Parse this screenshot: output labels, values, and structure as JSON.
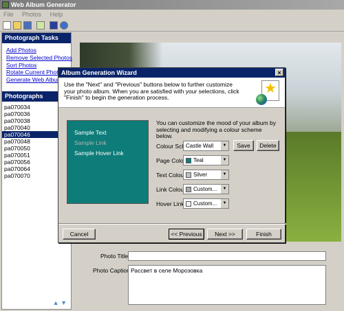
{
  "window": {
    "title": "Web Album Generator"
  },
  "menu": [
    "File",
    "Photos",
    "Help"
  ],
  "tasks": {
    "header": "Photograph Tasks",
    "items": [
      "Add Photos",
      "Remove Selected Photos",
      "Sort Photos",
      "Rotate Current Photo",
      "Generate Web Album"
    ]
  },
  "photographs": {
    "header": "Photographs",
    "items": [
      "pa070034",
      "pa070036",
      "pa070038",
      "pa070040",
      "pa070046",
      "pa070048",
      "pa070050",
      "pa070051",
      "pa070056",
      "pa070064",
      "pa070070"
    ],
    "selected": "pa070046"
  },
  "photo_title": {
    "label": "Photo Title:",
    "value": ""
  },
  "photo_caption": {
    "label": "Photo Caption:",
    "value": "Рассвет в селе Морозовка"
  },
  "dialog": {
    "title": "Album Generation Wizard",
    "close": "×",
    "description": "Use the \"Next\" and \"Previous\" buttons below to further customize your photo album. When you are satisfied with your selections, click \"Finish\" to begin the generation process.",
    "intro": "You can customize the mood of your album by selecting and modifying a colour scheme below.",
    "preview": {
      "text": "Sample Text",
      "link": "Sample Link",
      "hover": "Sample Hover Link",
      "bg_color": "#0e7c78"
    },
    "colour_scheme": {
      "label": "Colour Scheme:",
      "value": "Castle Wall"
    },
    "save": "Save",
    "delete": "Delete",
    "page_colour": {
      "label": "Page Colour:",
      "value": "Teal",
      "swatch": "#0e7c78"
    },
    "text_colour": {
      "label": "Text Colour:",
      "value": "Silver",
      "swatch": "#c0c0c0"
    },
    "link_colour": {
      "label": "Link Colour:",
      "value": "Custom...",
      "swatch": "#a8a8a8"
    },
    "hover_link_colour": {
      "label": "Hover Link Colour:",
      "value": "Custom...",
      "swatch": "#f0f0f0"
    },
    "cancel": "Cancel",
    "previous": "<< Previous",
    "next": "Next  >>",
    "finish": "Finish"
  }
}
